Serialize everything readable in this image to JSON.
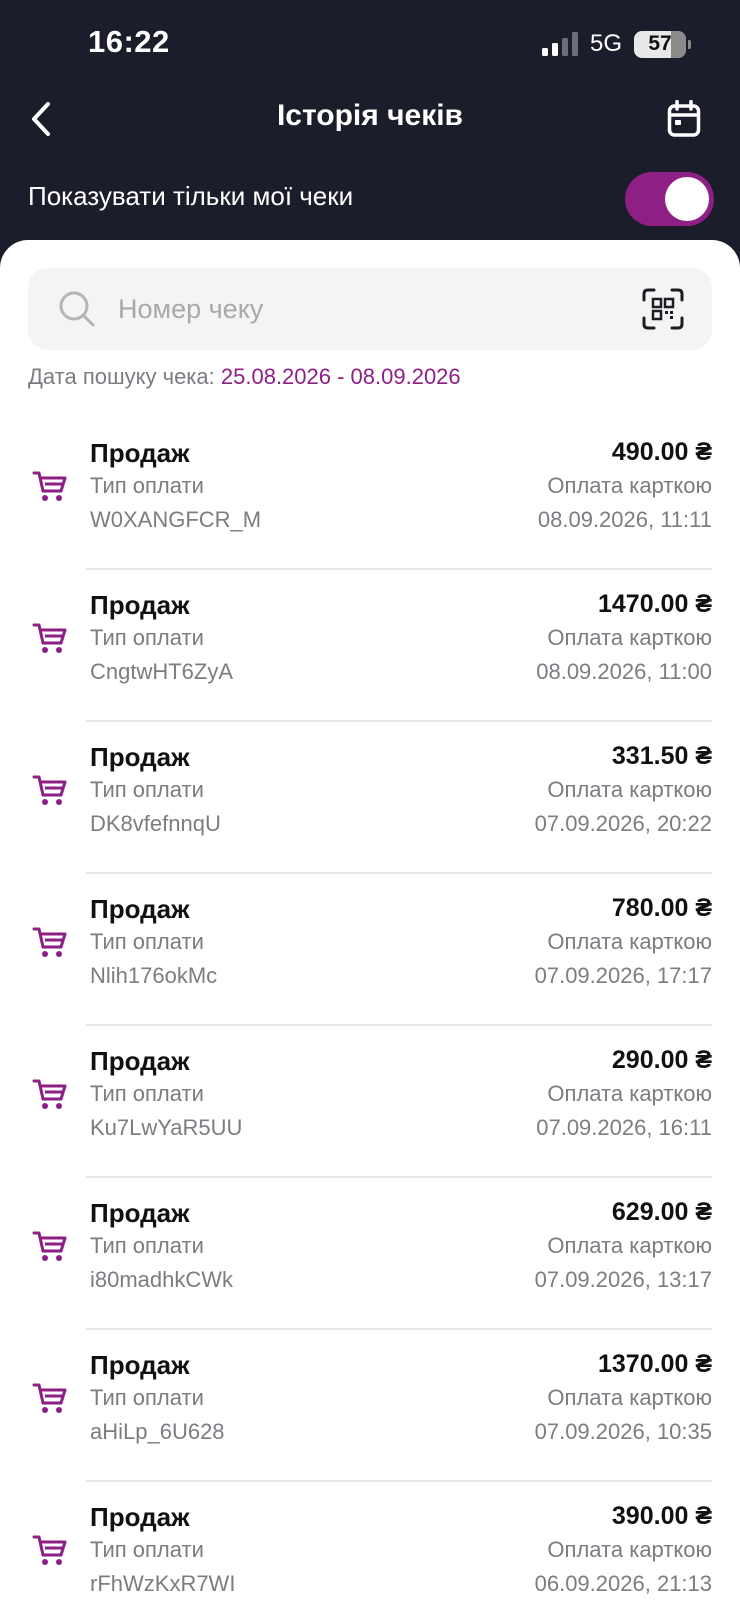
{
  "status_bar": {
    "time": "16:22",
    "network": "5G",
    "battery": "57"
  },
  "header": {
    "title": "Історія чеків"
  },
  "filter": {
    "only_mine_label": "Показувати тільки мої чеки",
    "only_mine_enabled": true
  },
  "search": {
    "placeholder": "Номер чеку",
    "value": ""
  },
  "date_range": {
    "label": "Дата пошуку чека:",
    "value": "25.08.2026 - 08.09.2026"
  },
  "colors": {
    "accent": "#8e1f84",
    "header_bg": "#1c1d2a"
  },
  "receipts": [
    {
      "title": "Продаж",
      "payment_label": "Тип оплати",
      "id": "W0XANGFCR_M",
      "amount": "490.00 ₴",
      "method": "Оплата карткою",
      "datetime": "08.09.2026, 11:11"
    },
    {
      "title": "Продаж",
      "payment_label": "Тип оплати",
      "id": "CngtwHT6ZyA",
      "amount": "1470.00 ₴",
      "method": "Оплата карткою",
      "datetime": "08.09.2026, 11:00"
    },
    {
      "title": "Продаж",
      "payment_label": "Тип оплати",
      "id": "DK8vfefnnqU",
      "amount": "331.50 ₴",
      "method": "Оплата карткою",
      "datetime": "07.09.2026, 20:22"
    },
    {
      "title": "Продаж",
      "payment_label": "Тип оплати",
      "id": "Nlih176okMc",
      "amount": "780.00 ₴",
      "method": "Оплата карткою",
      "datetime": "07.09.2026, 17:17"
    },
    {
      "title": "Продаж",
      "payment_label": "Тип оплати",
      "id": "Ku7LwYaR5UU",
      "amount": "290.00 ₴",
      "method": "Оплата карткою",
      "datetime": "07.09.2026, 16:11"
    },
    {
      "title": "Продаж",
      "payment_label": "Тип оплати",
      "id": "i80madhkCWk",
      "amount": "629.00 ₴",
      "method": "Оплата карткою",
      "datetime": "07.09.2026, 13:17"
    },
    {
      "title": "Продаж",
      "payment_label": "Тип оплати",
      "id": "aHiLp_6U628",
      "amount": "1370.00 ₴",
      "method": "Оплата карткою",
      "datetime": "07.09.2026, 10:35"
    },
    {
      "title": "Продаж",
      "payment_label": "Тип оплати",
      "id": "rFhWzKxR7WI",
      "amount": "390.00 ₴",
      "method": "Оплата карткою",
      "datetime": "06.09.2026, 21:13"
    }
  ]
}
